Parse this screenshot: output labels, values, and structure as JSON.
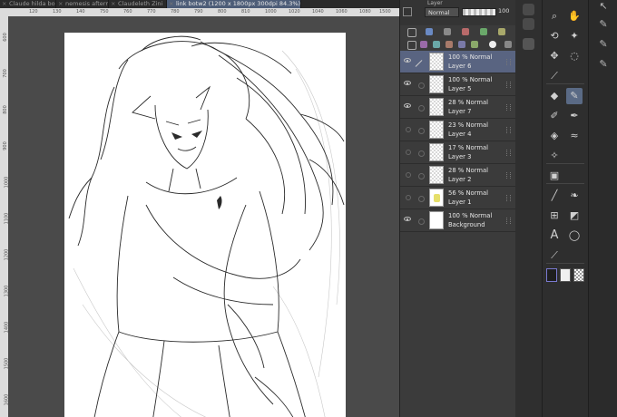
{
  "tabs": [
    {
      "label": "Claude hilda bo"
    },
    {
      "label": "nemesis afterm"
    },
    {
      "label": "Claudeleth Zini"
    },
    {
      "label": "link botw2 (1200 x 1800px 300dpi 84.3%)"
    }
  ],
  "ruler": {
    "h_ticks": [
      "120",
      "130",
      "140",
      "750",
      "760",
      "770",
      "780",
      "790",
      "800",
      "810",
      "1000",
      "1020",
      "1040",
      "1060",
      "1080",
      "1500",
      "1520"
    ],
    "v_ticks": [
      "600",
      "700",
      "800",
      "900",
      "1000",
      "1100",
      "1200",
      "1300",
      "1400",
      "1500",
      "1600"
    ]
  },
  "layer_panel": {
    "tab_label": "Layer",
    "blend_mode": "Normal",
    "opacity": "100",
    "layers": [
      {
        "pct": "100 %",
        "mode": "Normal",
        "name": "Layer 6",
        "visible": true,
        "selected": true,
        "thumb": "checker"
      },
      {
        "pct": "100 %",
        "mode": "Normal",
        "name": "Layer 5",
        "visible": true,
        "selected": false,
        "thumb": "checker"
      },
      {
        "pct": "28 %",
        "mode": "Normal",
        "name": "Layer 7",
        "visible": true,
        "selected": false,
        "thumb": "checker"
      },
      {
        "pct": "23 %",
        "mode": "Normal",
        "name": "Layer 4",
        "visible": false,
        "selected": false,
        "thumb": "checker"
      },
      {
        "pct": "17 %",
        "mode": "Normal",
        "name": "Layer 3",
        "visible": false,
        "selected": false,
        "thumb": "checker"
      },
      {
        "pct": "28 %",
        "mode": "Normal",
        "name": "Layer 2",
        "visible": false,
        "selected": false,
        "thumb": "checker"
      },
      {
        "pct": "56 %",
        "mode": "Normal",
        "name": "Layer 1",
        "visible": false,
        "selected": false,
        "thumb": "yellow"
      },
      {
        "pct": "100 %",
        "mode": "Normal",
        "name": "Background",
        "visible": true,
        "selected": false,
        "thumb": "white"
      }
    ]
  },
  "tools": {
    "items": [
      {
        "icon": "zoom-icon",
        "glyph": "🔍"
      },
      {
        "icon": "hand-icon",
        "glyph": "✋"
      },
      {
        "icon": "rotate-icon",
        "glyph": "⟲"
      },
      {
        "icon": "magic-wand-icon",
        "glyph": "✦"
      },
      {
        "icon": "move-icon",
        "glyph": "✥"
      },
      {
        "icon": "lasso-icon",
        "glyph": "◌"
      },
      {
        "icon": "eyedropper-icon",
        "glyph": "⟋"
      },
      {
        "icon": "eraser-icon",
        "glyph": "◆"
      },
      {
        "icon": "pen-icon",
        "glyph": "✎"
      },
      {
        "icon": "pencil-icon",
        "glyph": "✐"
      },
      {
        "icon": "brush-icon",
        "glyph": "✒"
      },
      {
        "icon": "fill-icon",
        "glyph": "◈"
      },
      {
        "icon": "airbrush-icon",
        "glyph": "≈"
      },
      {
        "icon": "sparkle-icon",
        "glyph": "✧"
      },
      {
        "icon": "gradient-icon",
        "glyph": "▣"
      },
      {
        "icon": "line-icon",
        "glyph": "╱"
      },
      {
        "icon": "blend-icon",
        "glyph": "❧"
      },
      {
        "icon": "frame-icon",
        "glyph": "⊞"
      },
      {
        "icon": "vector-icon",
        "glyph": "◩"
      },
      {
        "icon": "text-icon",
        "glyph": "A"
      },
      {
        "icon": "balloon-icon",
        "glyph": "◯"
      },
      {
        "icon": "correct-line-icon",
        "glyph": "⟋"
      }
    ]
  },
  "colors": {
    "main": "#1e1e1e",
    "sub": "#f0f0f0",
    "accent": "#596481"
  }
}
